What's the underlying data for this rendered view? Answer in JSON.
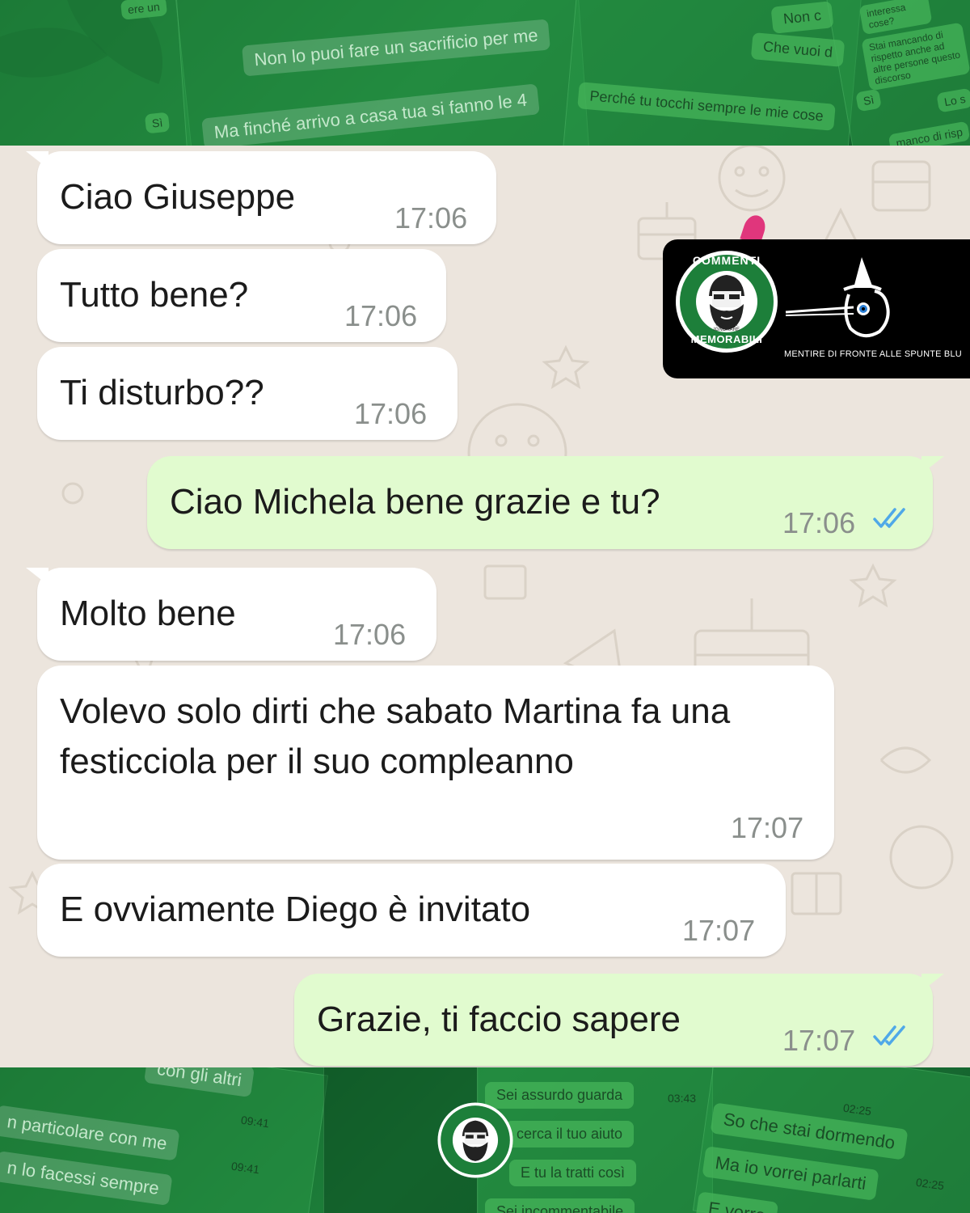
{
  "collage_top": {
    "frag1": "Non lo puoi fare un sacrificio per me",
    "frag2": "Ma finché arrivo a casa tua si fanno le 4",
    "frag3": "Perché tu tocchi sempre le mie cose",
    "frag4": "Non c",
    "frag5": "Che vuoi d",
    "frag6": "interessa cose?",
    "frag7": "Stai mancando di rispetto anche ad altre persone questo discorso",
    "frag8": "Sì",
    "frag9": "Lo s",
    "frag10": "manco di risp",
    "frag11": "Sì",
    "frag12": "ere un"
  },
  "collage_bottom": {
    "frag1": "con gli altri",
    "frag2": "n particolare con me",
    "frag3": "n lo facessi sempre",
    "time1": "09:41",
    "time2": "09:41",
    "frag4": "Sei assurdo guarda",
    "frag5": "cerca il tuo aiuto",
    "frag6": "E tu la tratti così",
    "frag7": "Sei incommentabile",
    "time3": "03:43",
    "frag8": "So che stai dormendo",
    "frag9": "Ma io vorrei parlarti",
    "frag10": "E vorre",
    "time4": "02:25",
    "time5": "02:25"
  },
  "brand": {
    "logo_top": "COMMENTI",
    "logo_bottom": "MEMORABILI",
    "logo_tagline": "NATI PER IGNORARE",
    "caption": "MENTIRE DI FRONTE ALLE SPUNTE BLU"
  },
  "messages": [
    {
      "dir": "in",
      "text": "Ciao Giuseppe",
      "time": "17:06"
    },
    {
      "dir": "in",
      "text": "Tutto bene?",
      "time": "17:06"
    },
    {
      "dir": "in",
      "text": "Ti disturbo??",
      "time": "17:06"
    },
    {
      "dir": "out",
      "text": "Ciao Michela bene grazie e tu?",
      "time": "17:06"
    },
    {
      "dir": "in",
      "text": "Molto bene",
      "time": "17:06"
    },
    {
      "dir": "in",
      "text": "Volevo solo dirti che sabato Martina fa una festicciola per il suo compleanno",
      "time": "17:07"
    },
    {
      "dir": "in",
      "text": "E ovviamente Diego è invitato",
      "time": "17:07"
    },
    {
      "dir": "out",
      "text": "Grazie, ti faccio sapere",
      "time": "17:07"
    }
  ],
  "colors": {
    "incoming_bubble": "#ffffff",
    "outgoing_bubble": "#e1fbcf",
    "read_ticks": "#4fa8e8",
    "chat_background": "#ece5dd",
    "brand_green": "#1d7f3a"
  },
  "icons": {
    "read_receipt": "double-check-icon",
    "pinocchio": "pinocchio-nose-icon"
  }
}
